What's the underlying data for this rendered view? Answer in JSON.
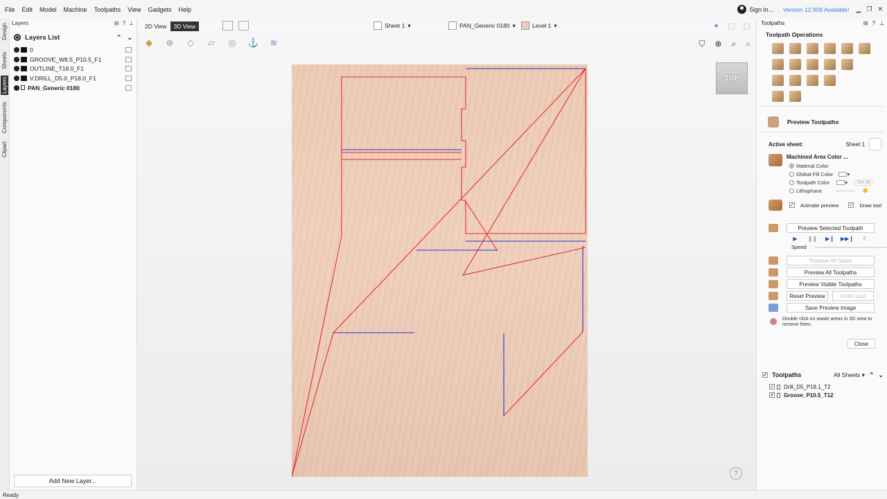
{
  "menu": [
    "File",
    "Edit",
    "Model",
    "Machine",
    "Toolpaths",
    "View",
    "Gadgets",
    "Help"
  ],
  "signin": "Sign in...",
  "version": "Version 12.009 Available!",
  "lefttabs": [
    "Design",
    "Sheets",
    "Layers",
    "Components",
    "Clipart"
  ],
  "layers_panel": {
    "header": "Layers",
    "title": "Layers List",
    "items": [
      "0",
      "GROOVE_W8.5_P10.5_F1",
      "OUTLINE_T18.0_F1",
      "V.DRILL_D5.0_P18.0_F1",
      "PAN_Generic 0180"
    ],
    "add_button": "Add New Layer..."
  },
  "viewport": {
    "view_2d": "2D View",
    "view_3d": "3D View",
    "sheet_combo": "Sheet 1",
    "material_combo": "PAN_Generic 0180",
    "level_combo": "Level 1",
    "cube_label": "TOP",
    "help": "?"
  },
  "toolpaths_panel": {
    "header": "Toolpaths",
    "operations_title": "Toolpath Operations",
    "preview_title": "Preview Toolpaths",
    "active_sheet_label": "Active sheet:",
    "active_sheet_value": "Sheet 1",
    "machined_color": "Machined Area Color ...",
    "options": [
      "Material Color",
      "Global Fill Color",
      "Toolpath Color",
      "Lithophane"
    ],
    "set_all": "Set All",
    "animate": "Animate preview",
    "draw_tool": "Draw tool",
    "preview_selected": "Preview Selected Toolpath",
    "speed": "Speed",
    "preview_all_sides": "Preview All Sides",
    "preview_all": "Preview All Toolpaths",
    "preview_visible": "Preview Visible Toolpaths",
    "reset_preview": "Reset Preview",
    "undo_last": "Undo Last",
    "save_image": "Save Preview Image",
    "hint": "Double click on waste areas in 3D view to remove them.",
    "close": "Close",
    "list_title": "Toolpaths",
    "list_filter": "All Sheets",
    "list_items": [
      "Drill_D5_P18.1_T2",
      "Groove_P10.5_T12"
    ]
  },
  "status": "Ready",
  "colors": {
    "outline": "#e03030",
    "groove": "#3030c8",
    "wood": "#eccab6"
  }
}
